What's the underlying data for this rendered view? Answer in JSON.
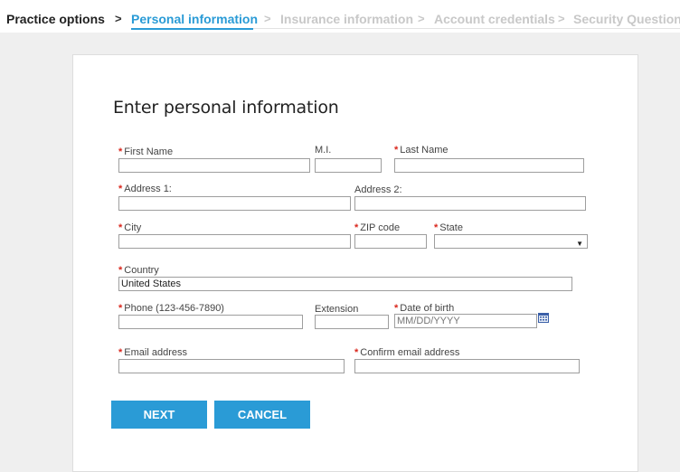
{
  "breadcrumb": {
    "steps": [
      {
        "label": "Practice options"
      },
      {
        "label": "Personal information"
      },
      {
        "label": "Insurance information"
      },
      {
        "label": "Account credentials"
      },
      {
        "label": "Security Questions"
      }
    ],
    "separator": ">"
  },
  "form": {
    "title": "Enter personal information",
    "fields": {
      "first_name": {
        "label": "First Name",
        "value": ""
      },
      "middle_initial": {
        "label": "M.I.",
        "value": ""
      },
      "last_name": {
        "label": "Last Name",
        "value": ""
      },
      "address1": {
        "label": "Address 1:",
        "value": ""
      },
      "address2": {
        "label": "Address 2:",
        "value": ""
      },
      "city": {
        "label": "City",
        "value": ""
      },
      "zip": {
        "label": "ZIP code",
        "value": ""
      },
      "state": {
        "label": "State",
        "value": ""
      },
      "country": {
        "label": "Country",
        "value": "United States"
      },
      "phone": {
        "label": "Phone (123-456-7890)",
        "value": ""
      },
      "extension": {
        "label": "Extension",
        "value": ""
      },
      "dob": {
        "label": "Date of birth",
        "placeholder": "MM/DD/YYYY"
      },
      "email": {
        "label": "Email address",
        "value": ""
      },
      "confirm_email": {
        "label": "Confirm email address",
        "value": ""
      }
    },
    "required_marker": "*"
  },
  "buttons": {
    "next": "NEXT",
    "cancel": "CANCEL"
  },
  "colors": {
    "accent": "#2a9bd6",
    "required": "#d9261c",
    "pending_step": "#c8c8c8"
  }
}
